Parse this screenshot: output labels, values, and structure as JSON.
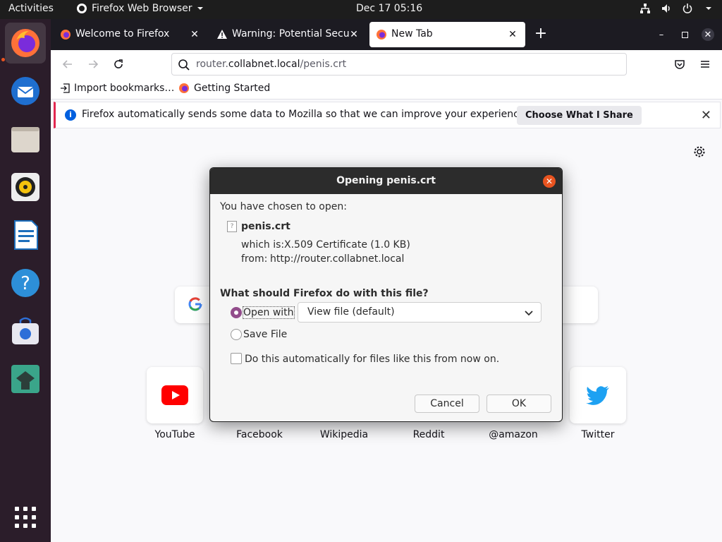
{
  "topbar": {
    "activities": "Activities",
    "app_menu": "Firefox Web Browser",
    "clock": "Dec 17  05:16",
    "tray_icons": [
      "network-icon",
      "volume-icon",
      "power-icon",
      "chevron-down-icon"
    ]
  },
  "dock": {
    "items": [
      "firefox",
      "thunderbird",
      "files",
      "rhythmbox",
      "libreoffice-writer",
      "help",
      "software-center",
      "app-tile",
      "show-apps"
    ],
    "accent_color": "#e95420"
  },
  "tabs": [
    {
      "title": "Welcome to Firefox",
      "icon": "firefox-icon"
    },
    {
      "title": "Warning: Potential Securi",
      "icon": "warning-icon"
    },
    {
      "title": "New Tab",
      "icon": "firefox-icon",
      "selected": true
    }
  ],
  "urlbar": {
    "prefix": "router.",
    "domain": "collabnet.local",
    "path": "/penis.crt"
  },
  "bookmarks": [
    {
      "label": "Import bookmarks…"
    },
    {
      "label": "Getting Started"
    }
  ],
  "notification": {
    "message": "Firefox automatically sends some data to Mozilla so that we can improve your experience.",
    "button": "Choose What I Share"
  },
  "top_sites": [
    {
      "label": "YouTube"
    },
    {
      "label": "Facebook"
    },
    {
      "label": "Wikipedia"
    },
    {
      "label": "Reddit"
    },
    {
      "label": "@amazon"
    },
    {
      "label": "Twitter"
    }
  ],
  "dialog": {
    "title": "Opening penis.crt",
    "chosen_label": "You have chosen to open:",
    "filename": "penis.crt",
    "which_is_label": "which is:",
    "which_is_value": "X.509 Certificate (1.0 KB)",
    "from_label": "from:",
    "from_value": "http://router.collabnet.local",
    "question": "What should Firefox do with this file?",
    "open_with_label": "Open with",
    "open_with_value": "View file (default)",
    "save_file_label": "Save File",
    "auto_label": "Do this automatically for files like this from now on.",
    "cancel": "Cancel",
    "ok": "OK",
    "selected_option": "open_with",
    "auto_checked": false
  }
}
